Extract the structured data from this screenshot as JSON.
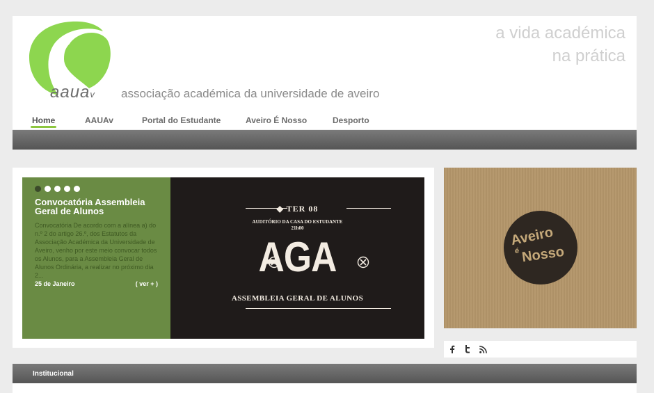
{
  "header": {
    "logo_text": "aaua",
    "logo_suffix": "v",
    "assoc_name": "associação académica da universidade de aveiro",
    "tagline_line1": "a vida académica",
    "tagline_line2": "na prática"
  },
  "nav": [
    {
      "label": "Home",
      "active": true
    },
    {
      "label": "AAUAv"
    },
    {
      "label": "Portal do Estudante"
    },
    {
      "label": "Aveiro É Nosso"
    },
    {
      "label": "Desporto"
    }
  ],
  "slider": {
    "dots": 5,
    "active_dot": 0,
    "title": "Convocatória Assembleia Geral de Alunos",
    "excerpt": "Convocatória De acordo com a alínea a) do n.º 2 do artigo 26.º, dos Estatutos da Associação Académica da Universidade de Aveiro, venho por este meio convocar todos os Alunos, para a Assembleia Geral de Alunos Ordinária, a realizar no próximo dia 2...",
    "date": "25 de Janeiro",
    "more_label": "( ver + )"
  },
  "poster": {
    "date_line": "TER 08",
    "venue": "AUDITÓRIO DA CASA DO ESTUDANTE",
    "time": "21h00",
    "title": "AGA",
    "subtitle": "ASSEMBLEIA GERAL DE ALUNOS"
  },
  "promo": {
    "word1": "Aveiro",
    "word2": "é",
    "word3": "Nosso"
  },
  "social": [
    "facebook-icon",
    "twitter-icon",
    "rss-icon"
  ],
  "bottom_bar": {
    "tab_label": "Institucional"
  },
  "colors": {
    "accent": "#8dc63f",
    "slide_bg": "#6a8b44",
    "poster_bg": "#1f1b1a"
  }
}
